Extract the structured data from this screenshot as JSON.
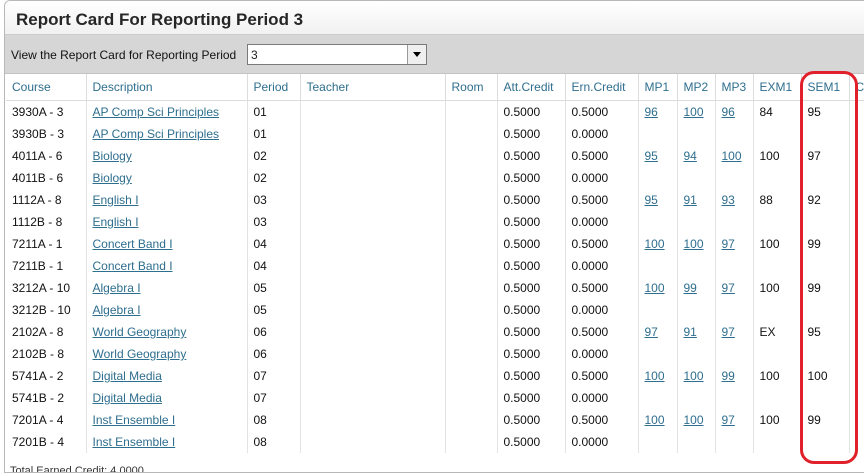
{
  "title": "Report Card For Reporting Period 3",
  "filter": {
    "label": "View the Report Card for Reporting Period",
    "selected": "3"
  },
  "columns": [
    "Course",
    "Description",
    "Period",
    "Teacher",
    "Room",
    "Att.Credit",
    "Ern.Credit",
    "MP1",
    "MP2",
    "MP3",
    "EXM1",
    "SEM1",
    "C"
  ],
  "rows": [
    {
      "course": "3930A - 3",
      "description": "AP Comp Sci Principles",
      "period": "01",
      "teacher": "",
      "room": "",
      "att": "0.5000",
      "ern": "0.5000",
      "mp1": "96",
      "mp2": "100",
      "mp3": "96",
      "exm1": "84",
      "sem1": "95"
    },
    {
      "course": "3930B - 3",
      "description": "AP Comp Sci Principles",
      "period": "01",
      "teacher": "",
      "room": "",
      "att": "0.5000",
      "ern": "0.0000",
      "mp1": "",
      "mp2": "",
      "mp3": "",
      "exm1": "",
      "sem1": ""
    },
    {
      "course": "4011A - 6",
      "description": "Biology",
      "period": "02",
      "teacher": "",
      "room": "",
      "att": "0.5000",
      "ern": "0.5000",
      "mp1": "95",
      "mp2": "94",
      "mp3": "100",
      "exm1": "100",
      "sem1": "97"
    },
    {
      "course": "4011B - 6",
      "description": "Biology",
      "period": "02",
      "teacher": "",
      "room": "",
      "att": "0.5000",
      "ern": "0.0000",
      "mp1": "",
      "mp2": "",
      "mp3": "",
      "exm1": "",
      "sem1": ""
    },
    {
      "course": "1112A - 8",
      "description": "English I",
      "period": "03",
      "teacher": "",
      "room": "",
      "att": "0.5000",
      "ern": "0.5000",
      "mp1": "95",
      "mp2": "91",
      "mp3": "93",
      "exm1": "88",
      "sem1": "92"
    },
    {
      "course": "1112B - 8",
      "description": "English I",
      "period": "03",
      "teacher": "",
      "room": "",
      "att": "0.5000",
      "ern": "0.0000",
      "mp1": "",
      "mp2": "",
      "mp3": "",
      "exm1": "",
      "sem1": ""
    },
    {
      "course": "7211A - 1",
      "description": "Concert Band I",
      "period": "04",
      "teacher": "",
      "room": "",
      "att": "0.5000",
      "ern": "0.5000",
      "mp1": "100",
      "mp2": "100",
      "mp3": "97",
      "exm1": "100",
      "sem1": "99"
    },
    {
      "course": "7211B - 1",
      "description": "Concert Band I",
      "period": "04",
      "teacher": "",
      "room": "",
      "att": "0.5000",
      "ern": "0.0000",
      "mp1": "",
      "mp2": "",
      "mp3": "",
      "exm1": "",
      "sem1": ""
    },
    {
      "course": "3212A - 10",
      "description": "Algebra I",
      "period": "05",
      "teacher": "",
      "room": "",
      "att": "0.5000",
      "ern": "0.5000",
      "mp1": "100",
      "mp2": "99",
      "mp3": "97",
      "exm1": "100",
      "sem1": "99"
    },
    {
      "course": "3212B - 10",
      "description": "Algebra I",
      "period": "05",
      "teacher": "",
      "room": "",
      "att": "0.5000",
      "ern": "0.0000",
      "mp1": "",
      "mp2": "",
      "mp3": "",
      "exm1": "",
      "sem1": ""
    },
    {
      "course": "2102A - 8",
      "description": "World Geography",
      "period": "06",
      "teacher": "",
      "room": "",
      "att": "0.5000",
      "ern": "0.5000",
      "mp1": "97",
      "mp2": "91",
      "mp3": "97",
      "exm1": "EX",
      "sem1": "95"
    },
    {
      "course": "2102B - 8",
      "description": "World Geography",
      "period": "06",
      "teacher": "",
      "room": "",
      "att": "0.5000",
      "ern": "0.0000",
      "mp1": "",
      "mp2": "",
      "mp3": "",
      "exm1": "",
      "sem1": ""
    },
    {
      "course": "5741A - 2",
      "description": "Digital Media",
      "period": "07",
      "teacher": "",
      "room": "",
      "att": "0.5000",
      "ern": "0.5000",
      "mp1": "100",
      "mp2": "100",
      "mp3": "99",
      "exm1": "100",
      "sem1": "100"
    },
    {
      "course": "5741B - 2",
      "description": "Digital Media",
      "period": "07",
      "teacher": "",
      "room": "",
      "att": "0.5000",
      "ern": "0.0000",
      "mp1": "",
      "mp2": "",
      "mp3": "",
      "exm1": "",
      "sem1": ""
    },
    {
      "course": "7201A - 4",
      "description": "Inst Ensemble I",
      "period": "08",
      "teacher": "",
      "room": "",
      "att": "0.5000",
      "ern": "0.5000",
      "mp1": "100",
      "mp2": "100",
      "mp3": "97",
      "exm1": "100",
      "sem1": "99"
    },
    {
      "course": "7201B - 4",
      "description": "Inst Ensemble I",
      "period": "08",
      "teacher": "",
      "room": "",
      "att": "0.5000",
      "ern": "0.0000",
      "mp1": "",
      "mp2": "",
      "mp3": "",
      "exm1": "",
      "sem1": ""
    }
  ],
  "footer": "Total Earned Credit: 4.0000",
  "colors": {
    "link": "#2e6e8e",
    "highlight": "#e0202a",
    "filter_bg": "#d6d6d6"
  }
}
